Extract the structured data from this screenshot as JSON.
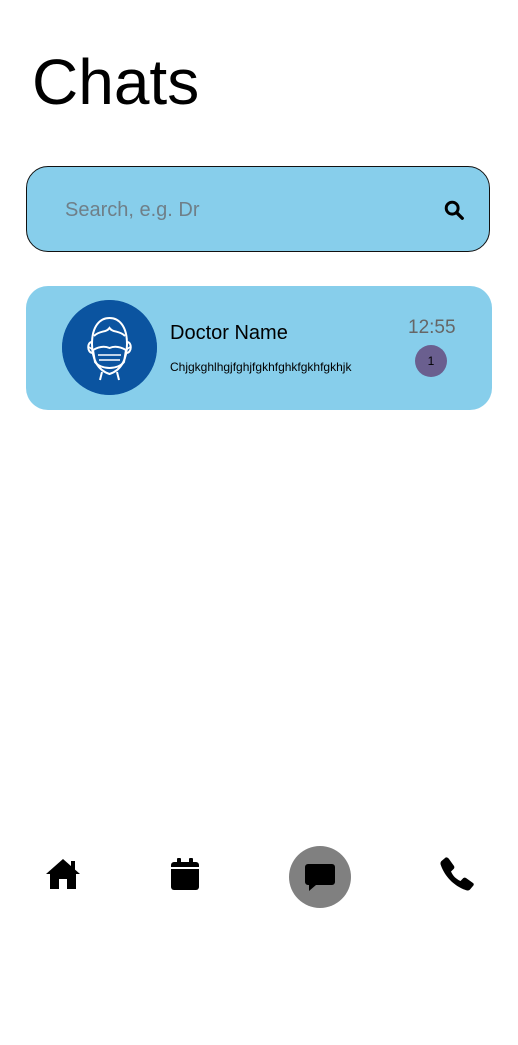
{
  "header": {
    "title": "Chats"
  },
  "search": {
    "placeholder": "Search, e.g. Dr",
    "value": "",
    "icon": "search-icon"
  },
  "chats": [
    {
      "name": "Doctor Name",
      "preview": "Chjgkghlhgjfghjfgkhfghkfgkhfgkhjk",
      "time": "12:55",
      "unread": "1",
      "avatar_icon": "face-mask-icon"
    }
  ],
  "nav": {
    "items": [
      {
        "icon": "home-icon",
        "active": false
      },
      {
        "icon": "calendar-icon",
        "active": false
      },
      {
        "icon": "chat-icon",
        "active": true
      },
      {
        "icon": "phone-icon",
        "active": false
      }
    ]
  },
  "colors": {
    "accent": "#87ceeb",
    "avatar_bg": "#0b54a0",
    "badge_bg": "#6a5f8f",
    "active_nav_bg": "#808080"
  }
}
